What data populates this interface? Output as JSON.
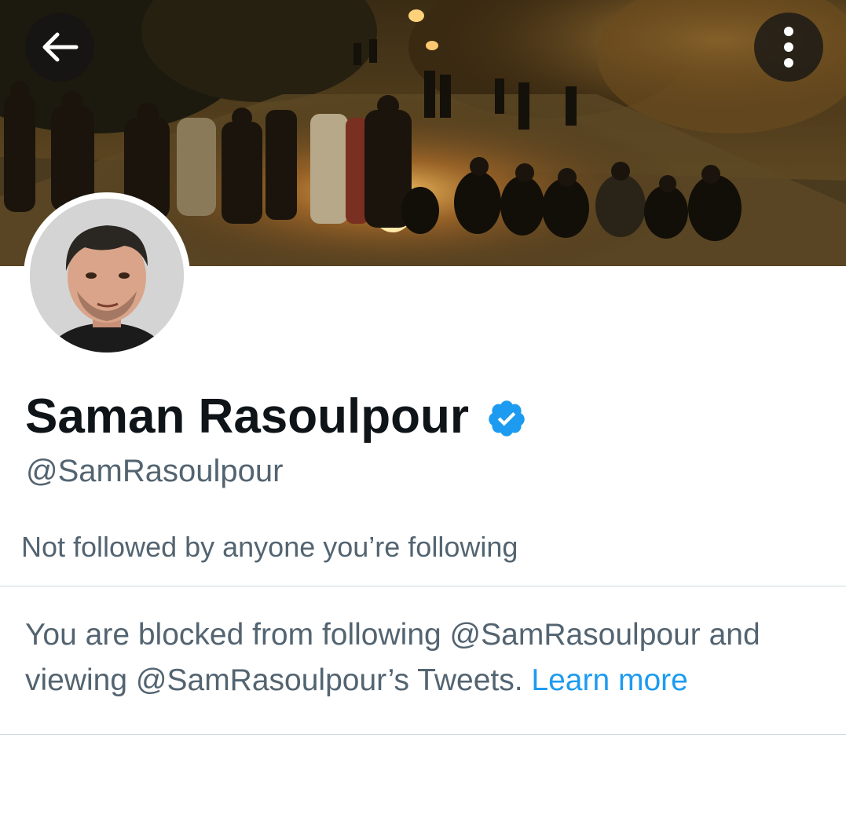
{
  "header": {
    "back_icon": "arrow-left-icon",
    "more_icon": "more-vertical-icon"
  },
  "profile": {
    "display_name": "Saman Rasoulpour",
    "handle": "@SamRasoulpour",
    "verified_icon": "verified-badge-icon",
    "followers_note": "Not followed by anyone you’re following"
  },
  "blocked_notice": {
    "message": "You are blocked from following @SamRasoulpour and viewing @SamRasoulpour’s Tweets.",
    "link_label": "Learn more"
  },
  "colors": {
    "primary_text": "#0f1419",
    "secondary_text": "#536471",
    "accent": "#1d9bf0",
    "divider": "#cfd9de"
  }
}
